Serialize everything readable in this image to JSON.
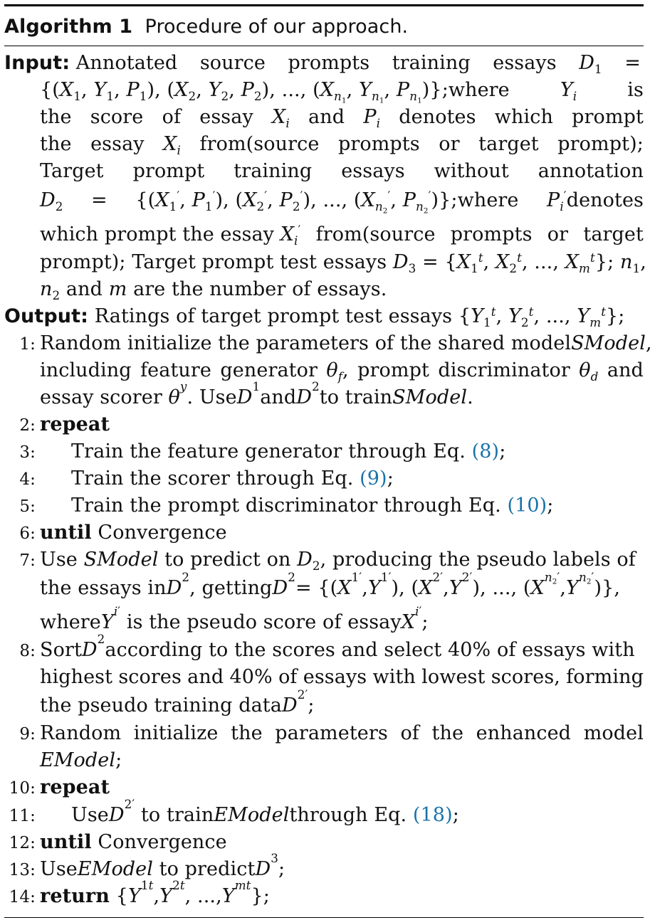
{
  "caption": {
    "label": "Algorithm 1",
    "title": "Procedure of our approach."
  },
  "input": {
    "label": "Input:",
    "l1": "Annotated source prompts training essays D1 =",
    "l2": "{(X1, Y1, P1), (X2, Y2, P2), ..., (Xn1, Yn1, Pn1)};where Yi is",
    "l3": "the score of essay Xi and Pi denotes which prompt",
    "l4": "the essay Xi from(source prompts or target prompt);",
    "l5": "Target prompt training essays without annotation",
    "l6": "D2 = {(X1', P1'), (X2', P2'), ..., (Xn2', Pn2')};where Pi' denotes",
    "l7": "which prompt the essay Xi' from(source prompts or target",
    "l8": "prompt); Target prompt test essays D3 = {X1t, X2t, ..., Xmt}; n1,",
    "l9": "n2 and m are the number of essays."
  },
  "output": {
    "label": "Output:",
    "text": "Ratings of target prompt test essays {Y1t, Y2t, ..., Ymt};"
  },
  "steps": [
    {
      "n": "1:",
      "lines": [
        "Random initialize the parameters of the shared model SModel,",
        "including feature generator θf, prompt discriminator θd and",
        "essay scorer θy. Use D1 and D2 to train SModel."
      ]
    },
    {
      "n": "2:",
      "lines": [
        "repeat"
      ]
    },
    {
      "n": "3:",
      "lines": [
        "Train the feature generator through Eq. (8);"
      ]
    },
    {
      "n": "4:",
      "lines": [
        "Train the scorer through Eq. (9);"
      ]
    },
    {
      "n": "5:",
      "lines": [
        "Train the prompt discriminator through Eq. (10);"
      ]
    },
    {
      "n": "6:",
      "lines": [
        "until Convergence"
      ]
    },
    {
      "n": "7:",
      "lines": [
        "Use SModel to predict on D2, producing the pseudo labels of",
        "the essays in D2, getting D2 = {(X1', Y1'), (X2', Y2'), ..., (Xn2', Yn2')},",
        "where Yi' is the pseudo score of essay Xi';"
      ]
    },
    {
      "n": "8:",
      "lines": [
        "Sort D2 according to the scores and select 40% of essays with",
        "highest scores and 40% of essays with lowest scores, forming",
        "the pseudo training data D2';"
      ]
    },
    {
      "n": "9:",
      "lines": [
        "Random initialize the parameters of the enhanced model",
        "EModel;"
      ]
    },
    {
      "n": "10:",
      "lines": [
        "repeat"
      ]
    },
    {
      "n": "11:",
      "lines": [
        "Use D2' to train EModel through Eq. (18);"
      ]
    },
    {
      "n": "12:",
      "lines": [
        "until Convergence"
      ]
    },
    {
      "n": "13:",
      "lines": [
        "Use EModel to predict D3;"
      ]
    },
    {
      "n": "14:",
      "lines": [
        "return {Y1t, Y2t, ..., Ymt};"
      ]
    }
  ],
  "colors": {
    "link": "#1a73a8",
    "rule": "#000000"
  }
}
